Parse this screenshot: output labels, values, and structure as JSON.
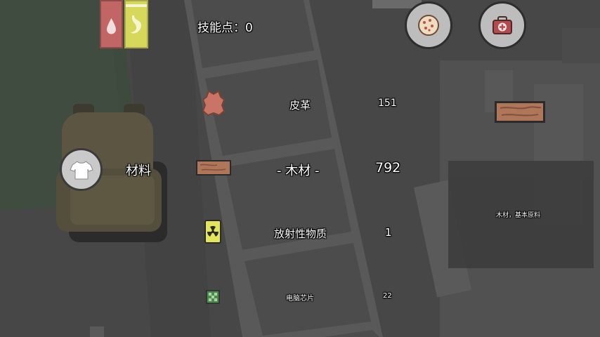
{
  "hud": {
    "skill_points": "技能点：0",
    "status_bars": [
      {
        "name": "thirst",
        "color": "#c26565",
        "icon": "water-drop-icon"
      },
      {
        "name": "hunger",
        "color": "#d6d85c",
        "icon": "stomach-icon"
      }
    ],
    "buttons": [
      {
        "name": "food-button",
        "icon": "cookie-icon"
      },
      {
        "name": "medkit-button",
        "icon": "medkit-icon"
      }
    ]
  },
  "inventory": {
    "category_label": "材料",
    "category_icon": "shirt-icon",
    "items": [
      {
        "name": "皮革",
        "count": "151",
        "icon": "leather-icon"
      },
      {
        "name": "- 木材 -",
        "count": "792",
        "icon": "wood-plank-icon",
        "selected": true
      },
      {
        "name": "放射性物质",
        "count": "1",
        "icon": "radioactive-icon"
      },
      {
        "name": "电脑芯片",
        "count": "22",
        "icon": "chip-icon"
      }
    ]
  },
  "detail": {
    "icon": "wood-plank-icon",
    "description": "木材，基本原料"
  }
}
